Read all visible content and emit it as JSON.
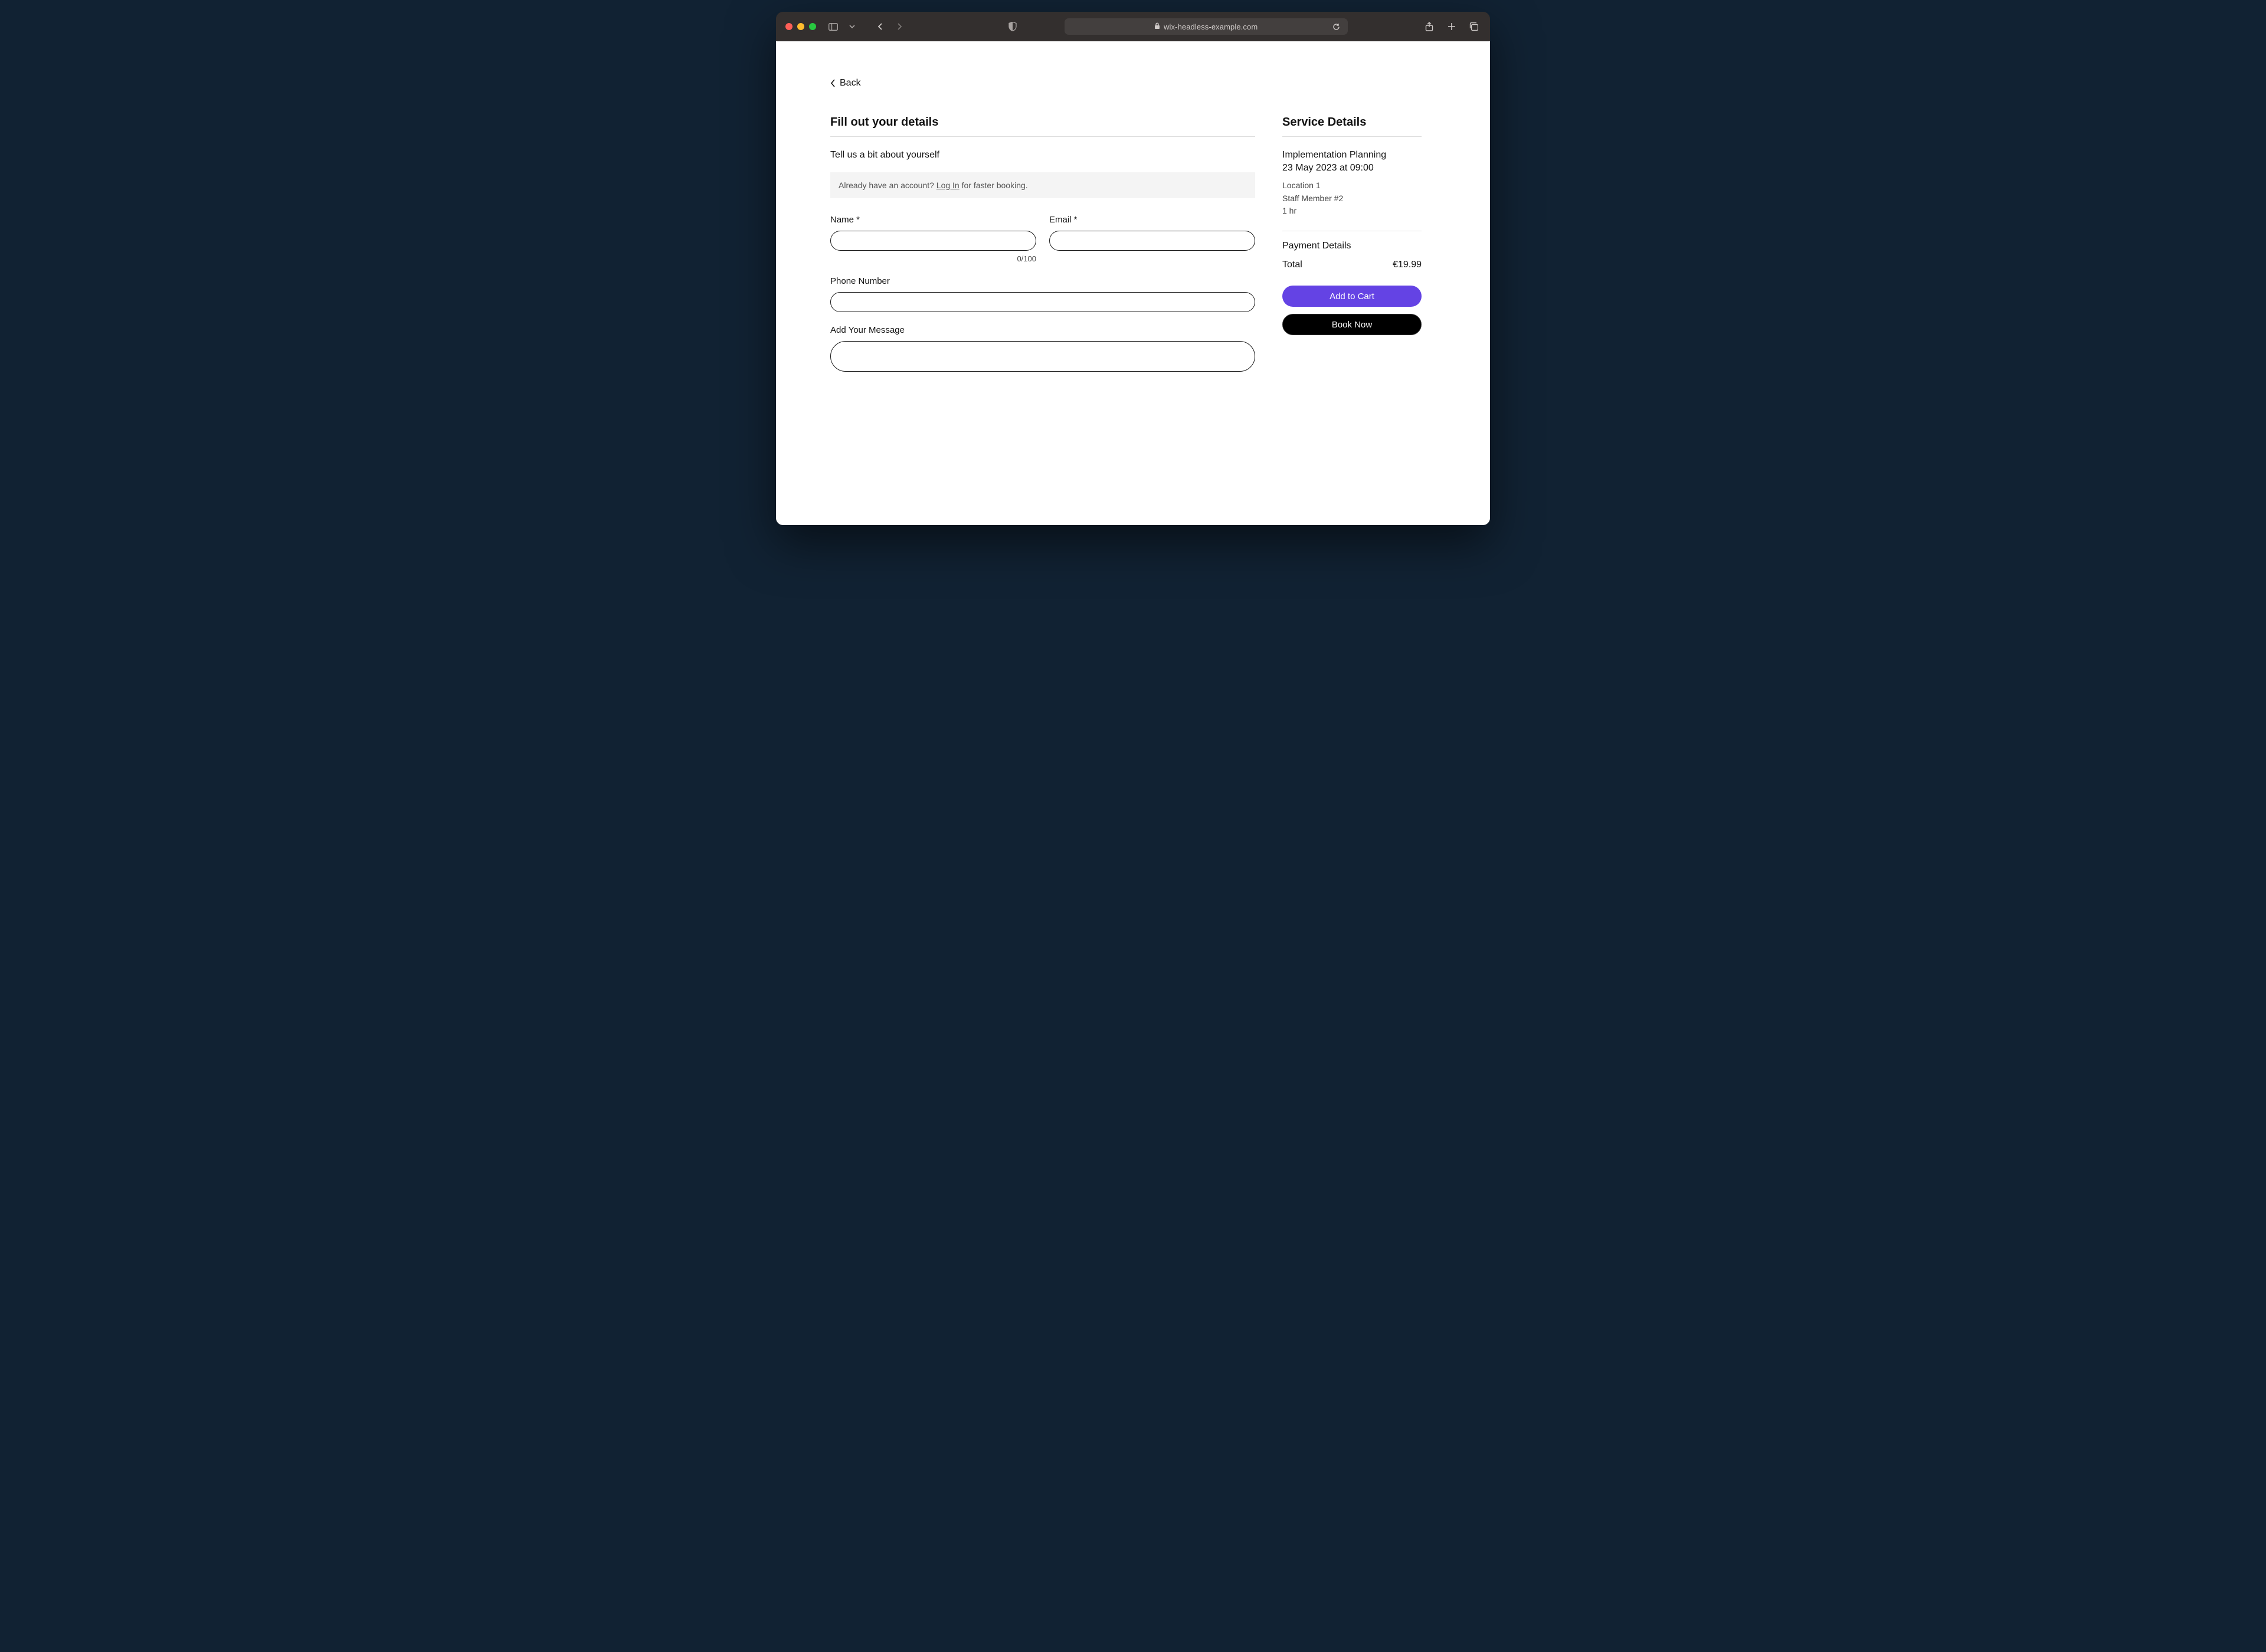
{
  "browser": {
    "host": "wix-headless-example.com"
  },
  "back_label": "Back",
  "form": {
    "heading": "Fill out your details",
    "subheading": "Tell us a bit about yourself",
    "login_prefix": "Already have an account? ",
    "login_link": "Log In",
    "login_suffix": " for faster booking.",
    "name_label": "Name *",
    "name_value": "",
    "name_counter": "0/100",
    "email_label": "Email *",
    "email_value": "",
    "phone_label": "Phone Number",
    "phone_value": "",
    "message_label": "Add Your Message",
    "message_value": ""
  },
  "service": {
    "heading": "Service Details",
    "name": "Implementation Planning",
    "datetime": "23 May 2023 at 09:00",
    "location": "Location 1",
    "staff": "Staff Member #2",
    "duration": "1 hr",
    "payment_heading": "Payment Details",
    "total_label": "Total",
    "total_value": "€19.99",
    "add_to_cart": "Add to Cart",
    "book_now": "Book Now"
  },
  "colors": {
    "accent": "#6443e4"
  }
}
